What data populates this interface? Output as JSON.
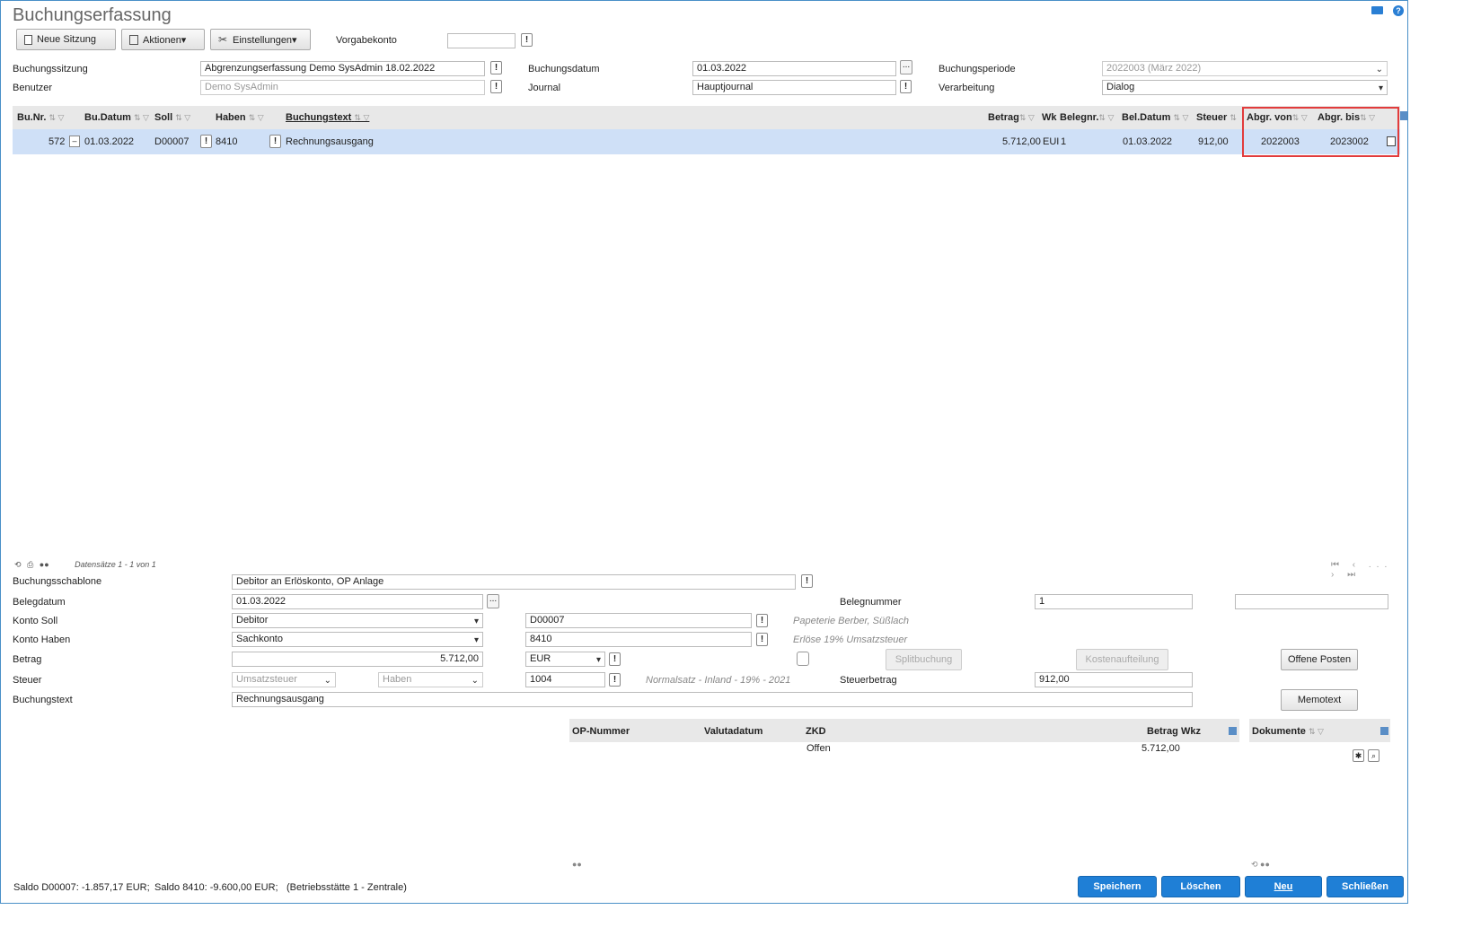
{
  "title": "Buchungserfassung",
  "toolbar": {
    "new_session": "Neue Sitzung",
    "actions": "Aktionen▾",
    "settings": "Einstellungen▾",
    "vorgabekonto_label": "Vorgabekonto",
    "vorgabekonto_value": ""
  },
  "header": {
    "buchungssitzung_label": "Buchungssitzung",
    "buchungssitzung_value": "Abgrenzungserfassung Demo SysAdmin 18.02.2022",
    "benutzer_label": "Benutzer",
    "benutzer_value": "Demo SysAdmin",
    "buchungsdatum_label": "Buchungsdatum",
    "buchungsdatum_value": "01.03.2022",
    "journal_label": "Journal",
    "journal_value": "Hauptjournal",
    "buchungsperiode_label": "Buchungsperiode",
    "buchungsperiode_value": "2022003 (März 2022)",
    "verarbeitung_label": "Verarbeitung",
    "verarbeitung_value": "Dialog"
  },
  "grid": {
    "columns": {
      "bunr": "Bu.Nr.",
      "budatum": "Bu.Datum",
      "soll": "Soll",
      "haben": "Haben",
      "buchungstext": "Buchungstext",
      "betrag": "Betrag",
      "wkz": "Wk",
      "belegnr": "Belegnr.",
      "beldatum": "Bel.Datum",
      "steuer": "Steuer",
      "abgr_von": "Abgr. von",
      "abgr_bis": "Abgr. bis"
    },
    "rows": [
      {
        "bunr": "572",
        "budatum": "01.03.2022",
        "soll": "D00007",
        "haben": "8410",
        "buchungstext": "Rechnungsausgang",
        "betrag": "5.712,00",
        "wkz": "EUI",
        "belegnr": "1",
        "beldatum": "01.03.2022",
        "steuer": "912,00",
        "abgr_von": "2022003",
        "abgr_bis": "2023002"
      }
    ]
  },
  "pager": {
    "text": "Datensätze 1 - 1 von 1",
    "middle": "..."
  },
  "detail": {
    "schablone_label": "Buchungsschablone",
    "schablone_value": "Debitor an Erlöskonto, OP Anlage",
    "belegdatum_label": "Belegdatum",
    "belegdatum_value": "01.03.2022",
    "belegnummer_label": "Belegnummer",
    "belegnummer_value": "1",
    "belegnummer_extra": "",
    "konto_soll_label": "Konto Soll",
    "konto_soll_type": "Debitor",
    "konto_soll_value": "D00007",
    "konto_soll_hint": "Papeterie Berber, Süßlach",
    "konto_haben_label": "Konto Haben",
    "konto_haben_type": "Sachkonto",
    "konto_haben_value": "8410",
    "konto_haben_hint": "Erlöse 19% Umsatzsteuer",
    "betrag_label": "Betrag",
    "betrag_value": "5.712,00",
    "waehrung": "EUR",
    "steuer_label": "Steuer",
    "steuer_type": "Umsatzsteuer",
    "steuer_side": "Haben",
    "steuer_code": "1004",
    "steuer_hint": "Normalsatz - Inland - 19% - 2021",
    "steuerbetrag_label": "Steuerbetrag",
    "steuerbetrag_value": "912,00",
    "buchungstext_label": "Buchungstext",
    "buchungstext_value": "Rechnungsausgang",
    "splitbuchung": "Splitbuchung",
    "kostenaufteilung": "Kostenaufteilung",
    "offene_posten": "Offene Posten",
    "memotext": "Memotext"
  },
  "op_grid": {
    "columns": {
      "op_nummer": "OP-Nummer",
      "valutadatum": "Valutadatum",
      "zkd": "ZKD",
      "betrag": "Betrag",
      "wkz": "Wkz"
    },
    "rows": [
      {
        "zkd": "Offen",
        "betrag": "5.712,00"
      }
    ]
  },
  "dokumente": {
    "label": "Dokumente"
  },
  "status": {
    "saldo_soll": "Saldo D00007: -1.857,17 EUR;",
    "saldo_haben": "Saldo 8410: -9.600,00 EUR;",
    "betriebsstaette": "(Betriebsstätte 1 - Zentrale)"
  },
  "footer_buttons": {
    "speichern": "Speichern",
    "loeschen": "Löschen",
    "neu": "Neu",
    "schliessen": "Schließen"
  },
  "colors": {
    "accent": "#1f7fd6",
    "highlight_row": "#cfe0f7",
    "red_box": "#e23c3c"
  }
}
